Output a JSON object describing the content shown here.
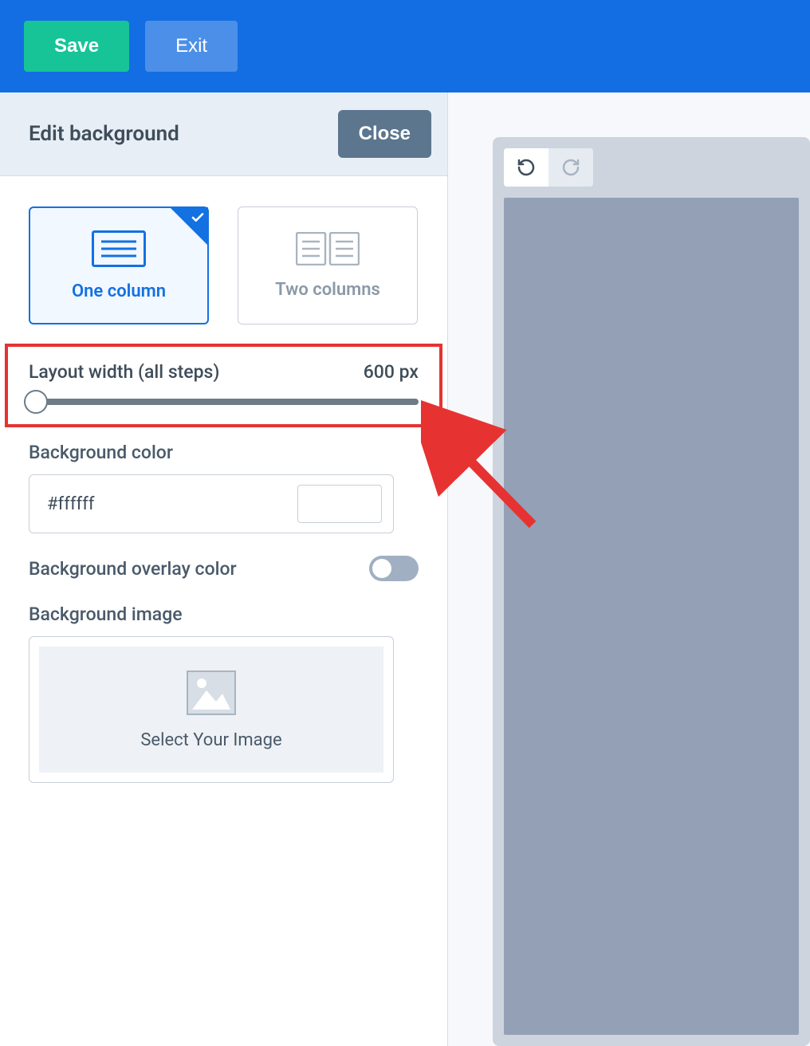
{
  "topbar": {
    "save": "Save",
    "exit": "Exit"
  },
  "panel": {
    "title": "Edit background",
    "close": "Close",
    "layouts": {
      "one_col": "One column",
      "two_col": "Two columns"
    },
    "width": {
      "label": "Layout width (all steps)",
      "value": "600 px"
    },
    "bg_color": {
      "label": "Background color",
      "value": "#ffffff"
    },
    "overlay": {
      "label": "Background overlay color"
    },
    "bg_image": {
      "label": "Background image",
      "select": "Select Your Image"
    }
  }
}
